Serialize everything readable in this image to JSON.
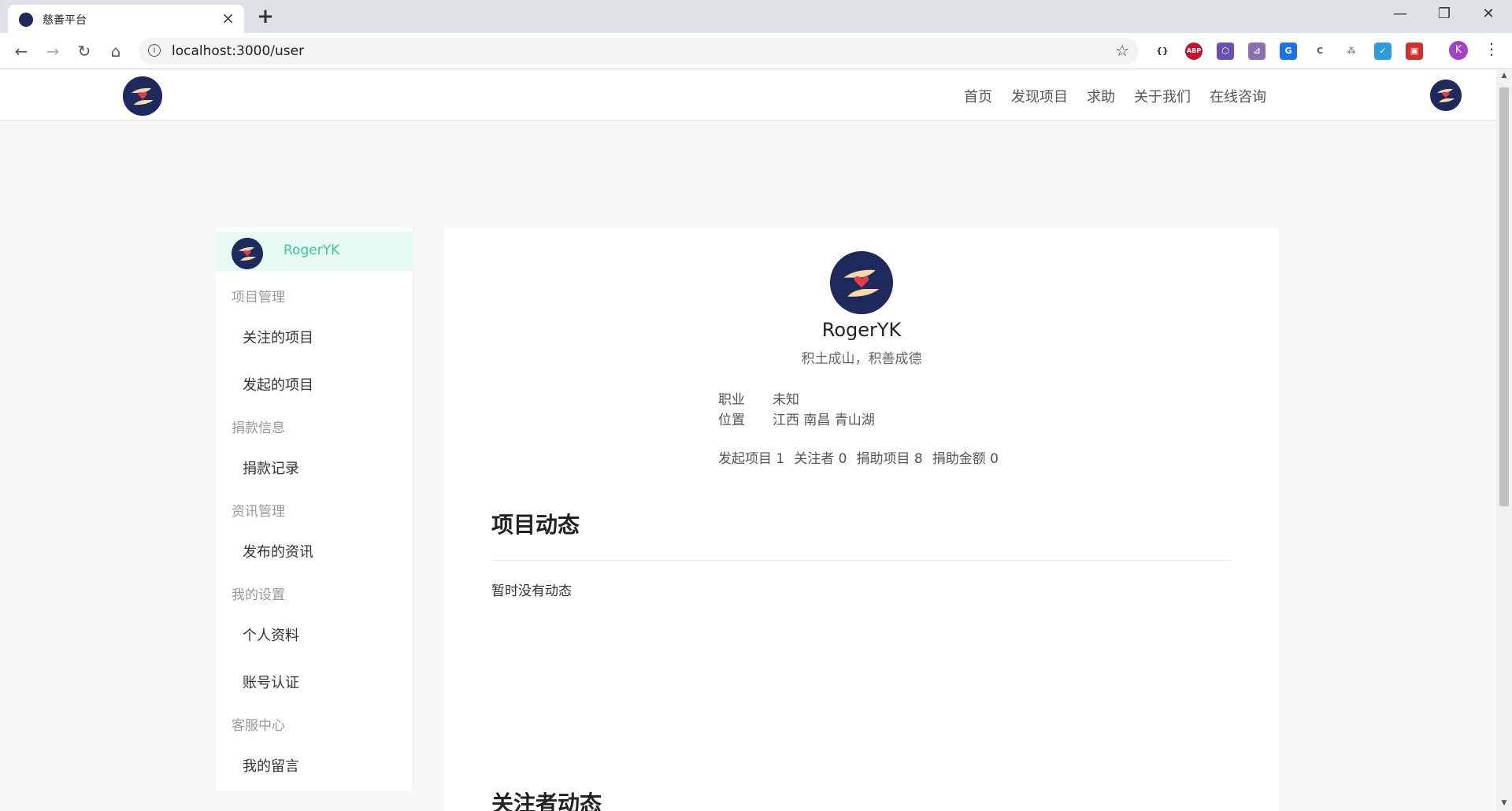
{
  "browser": {
    "tab_title": "慈善平台",
    "tab_close": "×",
    "new_tab": "+",
    "url": "localhost:3000/user",
    "profile_initial": "K",
    "controls": {
      "minimize": "—",
      "restore": "❐",
      "close": "✕"
    },
    "nav": {
      "back": "←",
      "forward": "→",
      "reload": "↻",
      "home": "⌂",
      "star": "☆",
      "menu": "⋮",
      "info": "i"
    },
    "extensions": [
      {
        "name": "json-viewer-icon",
        "label": "{}"
      },
      {
        "name": "adblock-plus-icon",
        "label": "ABP"
      },
      {
        "name": "cube-extension-icon",
        "label": "⬡"
      },
      {
        "name": "ruler-extension-icon",
        "label": "⊿"
      },
      {
        "name": "translate-extension-icon",
        "label": "G"
      },
      {
        "name": "css-extension-icon",
        "label": "C"
      },
      {
        "name": "tree-extension-icon",
        "label": "⁂"
      },
      {
        "name": "check-extension-icon",
        "label": "✓"
      },
      {
        "name": "screenshot-extension-icon",
        "label": "▣"
      }
    ]
  },
  "header": {
    "nav": [
      "首页",
      "发现项目",
      "求助",
      "关于我们",
      "在线咨询"
    ]
  },
  "sidebar": {
    "username": "RogerYK",
    "groups": [
      {
        "title": "项目管理",
        "items": [
          "关注的项目",
          "发起的项目"
        ]
      },
      {
        "title": "捐款信息",
        "items": [
          "捐款记录"
        ]
      },
      {
        "title": "资讯管理",
        "items": [
          "发布的资讯"
        ]
      },
      {
        "title": "我的设置",
        "items": [
          "个人资料",
          "账号认证"
        ]
      },
      {
        "title": "客服中心",
        "items": [
          "我的留言"
        ]
      }
    ]
  },
  "profile": {
    "name": "RogerYK",
    "motto": "积土成山，积善成德",
    "occupation_label": "职业",
    "occupation": "未知",
    "location_label": "位置",
    "location": "江西 南昌 青山湖",
    "stats": [
      "发起项目 1",
      "关注者 0",
      "捐助项目 8",
      "捐助金额 0"
    ]
  },
  "sections": {
    "project_feed_title": "项目动态",
    "project_feed_empty": "暂时没有动态",
    "follower_feed_title": "关注者动态"
  },
  "colors": {
    "accent": "#3bc99b",
    "sidebar_active_bg": "#e8faf4",
    "logo_bg": "#1f2a5c"
  }
}
